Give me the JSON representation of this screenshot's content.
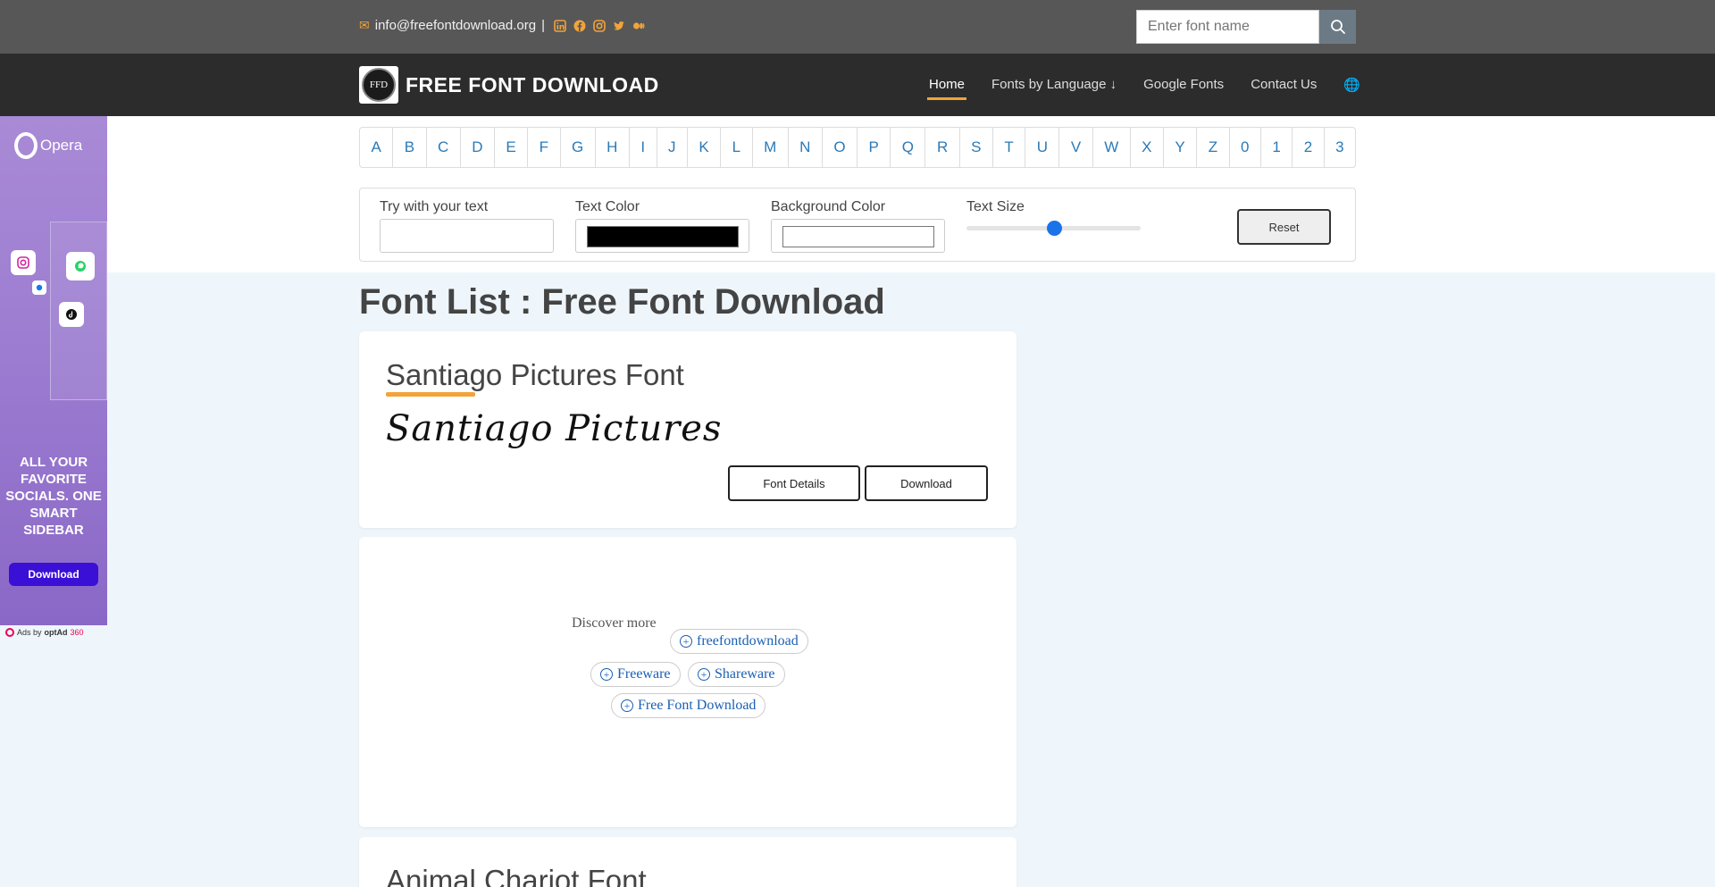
{
  "topbar": {
    "email": "info@freefontdownload.org",
    "separator": "|",
    "social_icons": [
      "linkedin-icon",
      "facebook-icon",
      "instagram-icon",
      "twitter-icon",
      "medium-icon"
    ],
    "search_placeholder": "Enter font name"
  },
  "brand": {
    "logo_text": "FFD",
    "name": "FREE FONT DOWNLOAD"
  },
  "nav": {
    "home": "Home",
    "fonts_by_language": "Fonts by Language",
    "fonts_by_language_arrow": "↓",
    "google_fonts": "Google Fonts",
    "contact_us": "Contact Us",
    "globe": "🌐"
  },
  "alphabet": [
    "A",
    "B",
    "C",
    "D",
    "E",
    "F",
    "G",
    "H",
    "I",
    "J",
    "K",
    "L",
    "M",
    "N",
    "O",
    "P",
    "Q",
    "R",
    "S",
    "T",
    "U",
    "V",
    "W",
    "X",
    "Y",
    "Z",
    "0",
    "1",
    "2",
    "3"
  ],
  "tester": {
    "try_label": "Try with your text",
    "text_color_label": "Text Color",
    "text_color_value": "#000000",
    "bg_color_label": "Background Color",
    "bg_color_value": "#ffffff",
    "size_label": "Text Size",
    "size_fraction": 0.5,
    "reset": "Reset"
  },
  "page": {
    "heading": "Font List : Free Font Download"
  },
  "fonts": [
    {
      "title": "Santiago Pictures Font",
      "preview": "Santiago Pictures",
      "details_label": "Font Details",
      "download_label": "Download"
    },
    {
      "title": "Animal Chariot Font"
    }
  ],
  "discover": {
    "label": "Discover more",
    "chips": [
      "freefontdownload",
      "Freeware",
      "Shareware",
      "Free Font Download"
    ]
  },
  "ad": {
    "brand": "Opera",
    "tagline": "ALL YOUR FAVORITE SOCIALS. ONE SMART SIDEBAR",
    "download": "Download",
    "ads_by_prefix": "Ads by",
    "ads_by_brand": "optAd",
    "ads_by_suffix": "360"
  },
  "colors": {
    "accent": "#f2a33a",
    "link": "#2a7ab8",
    "topbar": "#575757",
    "navbar": "#2c2c2c",
    "page_bg": "#eef6fc"
  }
}
